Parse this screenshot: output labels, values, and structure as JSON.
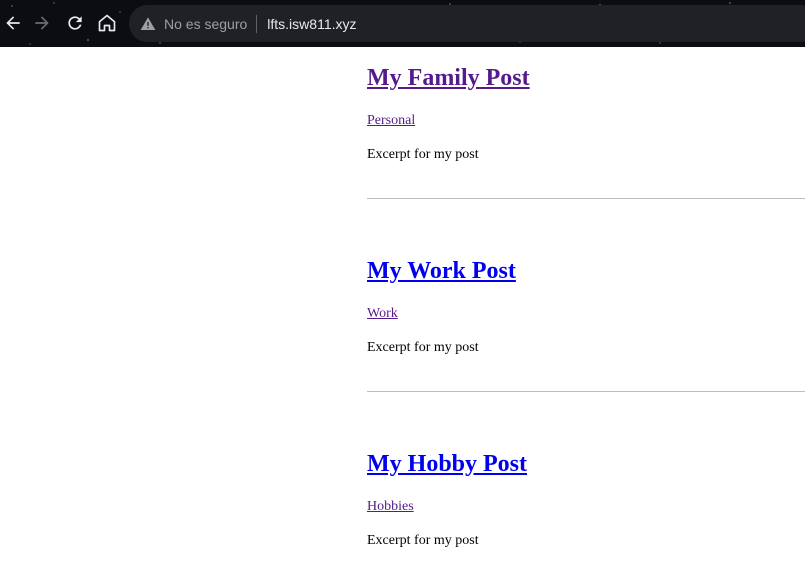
{
  "browser": {
    "security_label": "No es seguro",
    "url": "lfts.isw811.xyz",
    "icons": [
      "back-arrow-icon",
      "forward-arrow-icon",
      "reload-icon",
      "home-icon",
      "warning-triangle-icon"
    ]
  },
  "posts": [
    {
      "title": "My Family Post",
      "category": "Personal",
      "excerpt": "Excerpt for my post",
      "title_color": "#551a8b"
    },
    {
      "title": "My Work Post",
      "category": "Work",
      "excerpt": "Excerpt for my post",
      "title_color": "#0000ee"
    },
    {
      "title": "My Hobby Post",
      "category": "Hobbies",
      "excerpt": "Excerpt for my post",
      "title_color": "#0000ee"
    }
  ]
}
